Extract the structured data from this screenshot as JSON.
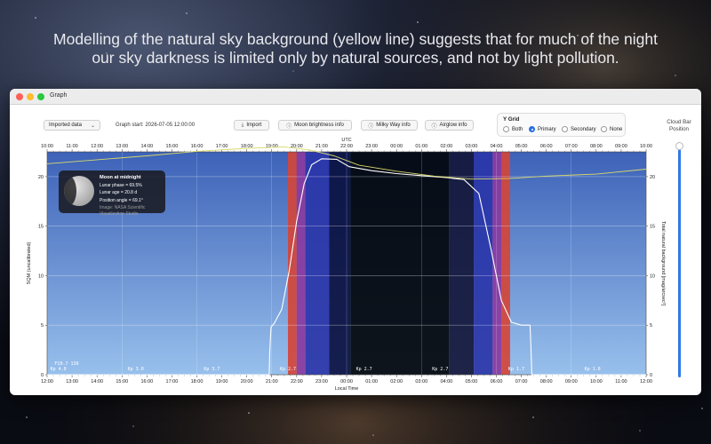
{
  "headline": {
    "line1": "Modelling of the natural sky background (yellow line) suggests that for much of the night",
    "line2": "our sky darkness is limited only by natural sources, and not by light pollution."
  },
  "window": {
    "title": "Graph"
  },
  "toolbar": {
    "data_popup": "Imported data",
    "graph_start": "Graph start: 2026-07-05 12:00:00",
    "import": "Import",
    "moon_info": "Moon brightness info",
    "milky_way_info": "Milky Way info",
    "airglow_info": "Airglow info",
    "ygrid": {
      "title": "Y Grid",
      "options": [
        "Both",
        "Primary",
        "Secondary",
        "None"
      ],
      "selected": "Primary"
    },
    "cloud_bar": "Cloud Bar\nPosition"
  },
  "moon_card": {
    "heading": "Moon at midnight",
    "phase": "Lunar phase = 69.5%",
    "age": "Lunar age = 20.8 d",
    "angle": "Position angle = 69.1°",
    "credit1": "Image: NASA Scientific",
    "credit2": "Visualization Studio"
  },
  "chart_data": {
    "type": "line",
    "top_axis_title": "UTC",
    "xlabel": "Local Time",
    "ylabel": "SQM (uncalibrated)",
    "y2label": "Total natural background [mag/arcsec²]",
    "utc_ticks": [
      "10:00",
      "11:00",
      "12:00",
      "13:00",
      "14:00",
      "15:00",
      "16:00",
      "17:00",
      "18:00",
      "19:00",
      "20:00",
      "21:00",
      "22:00",
      "23:00",
      "00:00",
      "01:00",
      "02:00",
      "03:00",
      "04:00",
      "05:00",
      "06:00",
      "07:00",
      "08:00",
      "09:00",
      "10:00"
    ],
    "local_ticks": [
      "12:00",
      "13:00",
      "14:00",
      "15:00",
      "16:00",
      "17:00",
      "18:00",
      "19:00",
      "20:00",
      "21:00",
      "22:00",
      "23:00",
      "00:00",
      "01:00",
      "02:00",
      "03:00",
      "04:00",
      "05:00",
      "06:00",
      "07:00",
      "08:00",
      "09:00",
      "10:00",
      "11:00",
      "12:00"
    ],
    "ylim": [
      0,
      22.5
    ],
    "y_ticks": [
      0,
      5,
      10,
      15,
      20
    ],
    "twilight_bands": [
      {
        "from": 9.65,
        "to": 10.0,
        "color": "#d4453a"
      },
      {
        "from": 10.0,
        "to": 10.35,
        "color": "#8a3aa0"
      },
      {
        "from": 10.35,
        "to": 11.3,
        "color": "#2a35a8"
      },
      {
        "from": 11.3,
        "to": 12.15,
        "color": "#0a1040"
      },
      {
        "from": 12.15,
        "to": 16.1,
        "color": "#02050a"
      },
      {
        "from": 16.1,
        "to": 17.1,
        "color": "#14163a"
      },
      {
        "from": 17.1,
        "to": 17.85,
        "color": "#2a35a8"
      },
      {
        "from": 17.85,
        "to": 18.2,
        "color": "#8a3aa0"
      },
      {
        "from": 18.2,
        "to": 18.55,
        "color": "#d4453a"
      }
    ],
    "kp_labels": [
      {
        "x": 0.45,
        "text": "Kp 4.0"
      },
      {
        "x": 3.55,
        "text": "Kp 3.0"
      },
      {
        "x": 6.6,
        "text": "Kp 3.7"
      },
      {
        "x": 9.65,
        "text": "Kp 2.7"
      },
      {
        "x": 12.7,
        "text": "Kp 2.7"
      },
      {
        "x": 15.75,
        "text": "Kp 2.7"
      },
      {
        "x": 18.8,
        "text": "Kp 1.7"
      },
      {
        "x": 21.85,
        "text": "Kp 1.0"
      }
    ],
    "f107_label": "F10.7 139",
    "series": [
      {
        "color": "#ffffff",
        "points": [
          [
            0,
            0
          ],
          [
            8.9,
            0
          ],
          [
            8.92,
            2.3
          ],
          [
            8.97,
            4.8
          ],
          [
            9.1,
            5.2
          ],
          [
            9.4,
            6.6
          ],
          [
            9.7,
            10.5
          ],
          [
            10.0,
            15.5
          ],
          [
            10.3,
            19.3
          ],
          [
            10.6,
            21.2
          ],
          [
            11.0,
            21.8
          ],
          [
            11.6,
            21.75
          ],
          [
            12.1,
            21.0
          ],
          [
            13.0,
            20.6
          ],
          [
            14.0,
            20.3
          ],
          [
            15.0,
            20.1
          ],
          [
            16.0,
            19.9
          ],
          [
            16.7,
            19.7
          ],
          [
            17.3,
            18.3
          ],
          [
            17.8,
            12.5
          ],
          [
            18.2,
            7.5
          ],
          [
            18.6,
            5.3
          ],
          [
            19.0,
            5.0
          ],
          [
            19.35,
            5.0
          ],
          [
            19.38,
            3.0
          ],
          [
            19.42,
            0
          ],
          [
            24,
            0
          ]
        ]
      },
      {
        "color": "#d8d86a",
        "points": [
          [
            0,
            21.3
          ],
          [
            2,
            21.7
          ],
          [
            4,
            22.1
          ],
          [
            6,
            22.55
          ],
          [
            8,
            22.85
          ],
          [
            9.5,
            23.0
          ],
          [
            10.5,
            22.7
          ],
          [
            11.5,
            22.1
          ],
          [
            12.5,
            21.15
          ],
          [
            14,
            20.55
          ],
          [
            15.5,
            20.05
          ],
          [
            17,
            19.75
          ],
          [
            18.5,
            19.8
          ],
          [
            20,
            20.05
          ],
          [
            22,
            20.25
          ],
          [
            24,
            20.75
          ]
        ]
      }
    ]
  }
}
